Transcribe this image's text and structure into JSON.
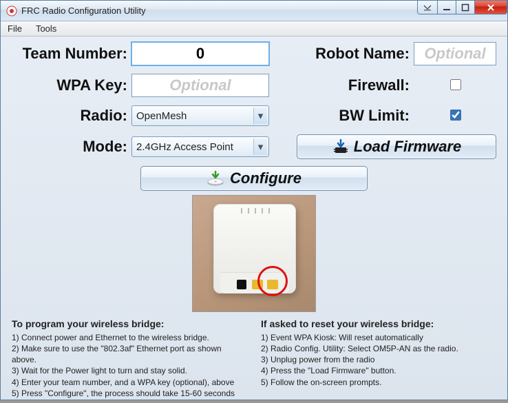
{
  "window": {
    "title": "FRC Radio Configuration Utility"
  },
  "menu": {
    "file": "File",
    "tools": "Tools"
  },
  "labels": {
    "team_number": "Team Number:",
    "wpa_key": "WPA Key:",
    "radio": "Radio:",
    "mode": "Mode:",
    "robot_name": "Robot Name:",
    "firewall": "Firewall:",
    "bw_limit": "BW Limit:"
  },
  "fields": {
    "team_number_value": "0",
    "wpa_key_placeholder": "Optional",
    "robot_name_placeholder": "Optional",
    "radio_selected": "OpenMesh",
    "mode_selected": "2.4GHz Access Point",
    "firewall_checked": false,
    "bw_limit_checked": true
  },
  "buttons": {
    "load_firmware": "Load Firmware",
    "configure": "Configure"
  },
  "instructions": {
    "left_heading": "To program your wireless bridge:",
    "left_1": "1) Connect power and Ethernet to the wireless bridge.",
    "left_2": "2) Make sure to use the \"802.3af\" Ethernet port as shown above.",
    "left_3": "3) Wait for the Power light to turn and stay solid.",
    "left_4": "4) Enter your team number, and a WPA key (optional), above",
    "left_5": "5) Press \"Configure\", the process should take 15-60 seconds",
    "right_heading": "If asked to reset your wireless bridge:",
    "right_1": "1) Event WPA Kiosk: Will reset automatically",
    "right_2": "2) Radio Config. Utility: Select OM5P-AN as the radio.",
    "right_3": "3) Unplug power from the radio",
    "right_4": "4) Press the \"Load Firmware\" button.",
    "right_5": "5) Follow the on-screen prompts."
  }
}
